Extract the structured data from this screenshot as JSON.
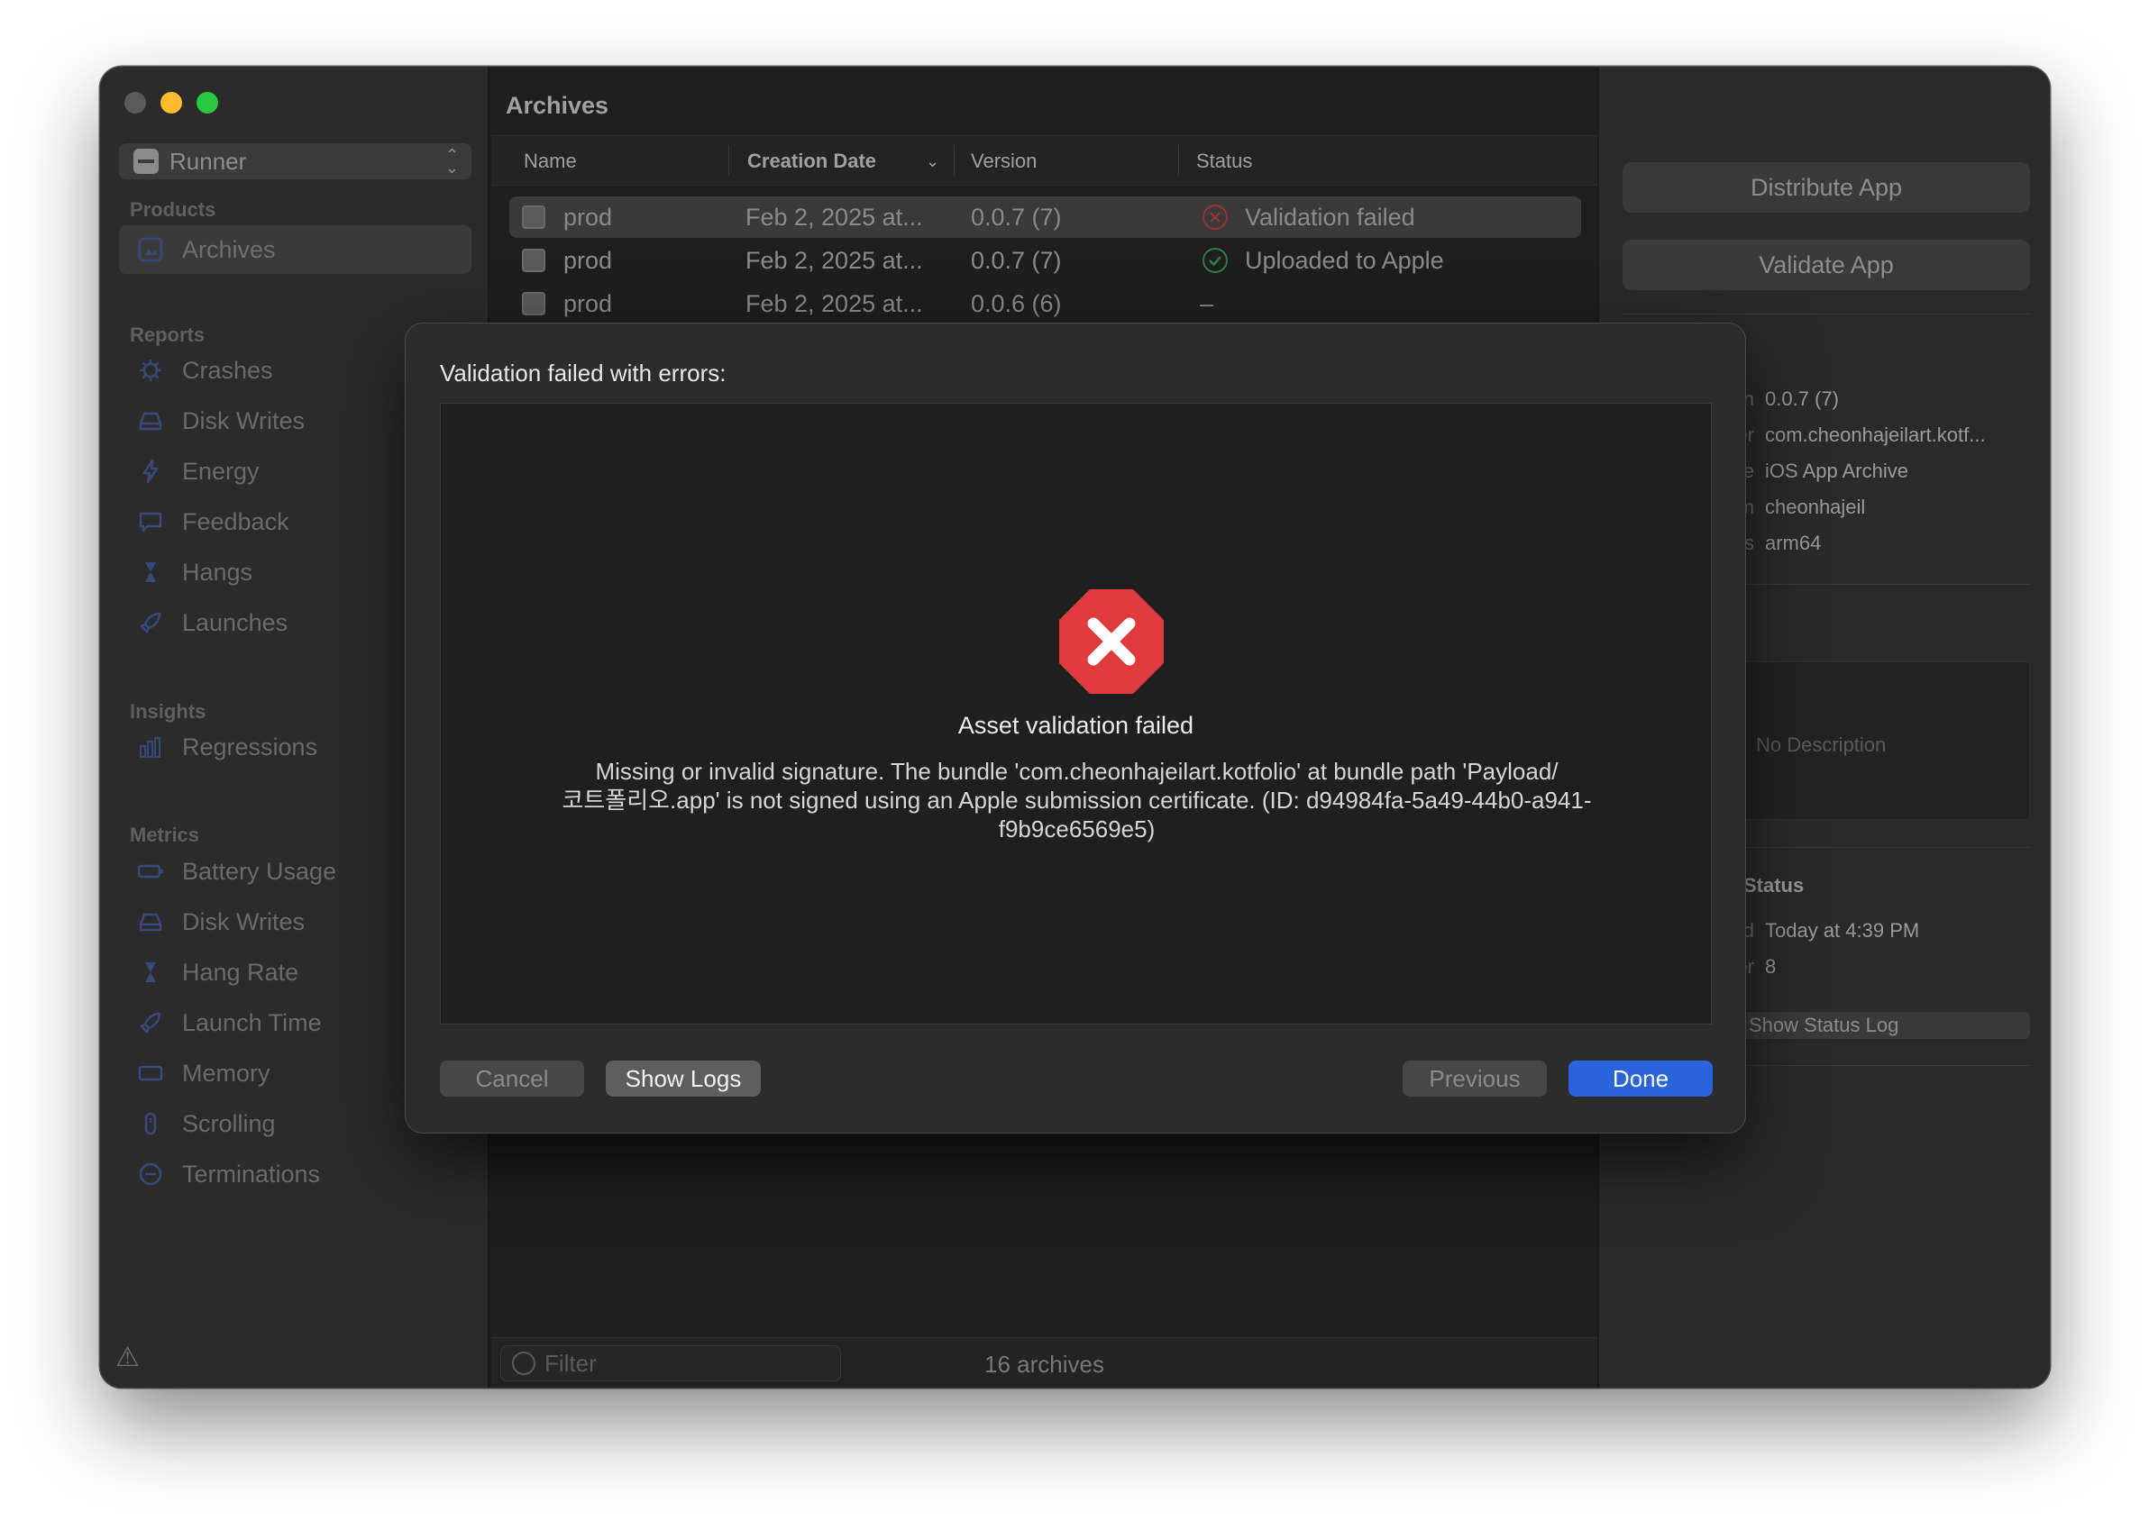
{
  "sidebar": {
    "scheme": "Runner",
    "sections": {
      "products": "Products",
      "reports": "Reports",
      "insights": "Insights",
      "metrics": "Metrics"
    },
    "archives": "Archives",
    "reports": [
      "Crashes",
      "Disk Writes",
      "Energy",
      "Feedback",
      "Hangs",
      "Launches"
    ],
    "insights": [
      "Regressions"
    ],
    "metrics": [
      "Battery Usage",
      "Disk Writes",
      "Hang Rate",
      "Launch Time",
      "Memory",
      "Scrolling",
      "Terminations"
    ]
  },
  "main": {
    "title": "Archives",
    "columns": [
      "Name",
      "Creation Date",
      "Version",
      "Status"
    ],
    "rows": [
      {
        "name": "prod",
        "date": "Feb 2, 2025 at...",
        "version": "0.0.7 (7)",
        "status": "Validation failed"
      },
      {
        "name": "prod",
        "date": "Feb 2, 2025 at...",
        "version": "0.0.7 (7)",
        "status": "Uploaded to Apple"
      },
      {
        "name": "prod",
        "date": "Feb 2, 2025 at...",
        "version": "0.0.6 (6)",
        "status": "–"
      }
    ],
    "filter_placeholder": "Filter",
    "archive_count": "16 archives"
  },
  "inspector": {
    "distribute": "Distribute App",
    "validate": "Validate App",
    "details": [
      {
        "k": "n",
        "v": "0.0.7 (7)"
      },
      {
        "k": "er",
        "v": "com.cheonhajeilart.kotf..."
      },
      {
        "k": "e",
        "v": "iOS App Archive"
      },
      {
        "k": "m",
        "v": "cheonhajeil"
      },
      {
        "k": "s",
        "v": "arm64"
      }
    ],
    "description_placeholder": "No Description",
    "status_title": "Status",
    "status_rows": [
      {
        "k": "d",
        "v": "Today at 4:39 PM"
      },
      {
        "k": "er",
        "v": "8"
      }
    ],
    "show_status_log": "Show Status Log"
  },
  "dialog": {
    "title": "Validation failed with errors:",
    "heading": "Asset validation failed",
    "message_lines": [
      "Missing or invalid signature. The bundle 'com.cheonhajeilart.kotfolio' at bundle path 'Payload/",
      "코트폴리오.app' is not signed using an Apple submission certificate. (ID: d94984fa-5a49-44b0-a941-",
      "f9b9ce6569e5)"
    ],
    "buttons": {
      "cancel": "Cancel",
      "show_logs": "Show Logs",
      "previous": "Previous",
      "done": "Done"
    }
  },
  "colors": {
    "accent": "#2a64dc",
    "error": "#e0393e",
    "success": "#2fa34a"
  }
}
